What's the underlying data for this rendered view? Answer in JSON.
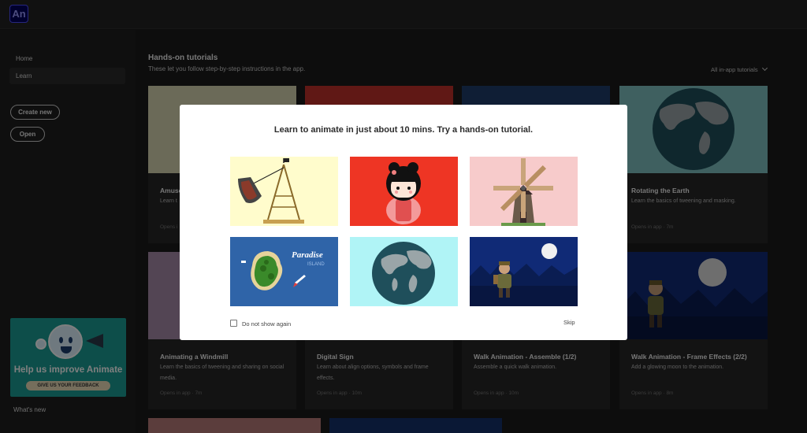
{
  "app": {
    "logo_text": "An",
    "brand_color": "#00005b"
  },
  "sidebar": {
    "items": [
      {
        "label": "Home"
      },
      {
        "label": "Learn",
        "active": true
      }
    ],
    "create_new": "Create new",
    "open": "Open",
    "promo": {
      "title": "Help us improve Animate",
      "button": "GIVE US YOUR FEEDBACK"
    },
    "whats_new": "What's new"
  },
  "main": {
    "title": "Hands-on tutorials",
    "subtitle": "These let you follow step-by-step instructions in the app.",
    "filter": "All in-app tutorials",
    "cards": [
      {
        "title": "Amuse",
        "desc": "Learn t",
        "meta": "Opens i"
      },
      {
        "title": "",
        "desc": "",
        "meta": ""
      },
      {
        "title": "",
        "desc": "",
        "meta": ""
      },
      {
        "title": "Rotating the Earth",
        "desc": "Learn the basics of tweening and masking.",
        "meta": "Opens in app  ·  7m"
      },
      {
        "title": "Animating a Windmill",
        "desc": "Learn the basics of tweening and sharing on social media.",
        "meta": "Opens in app  ·  7m"
      },
      {
        "title": "Digital Sign",
        "desc": "Learn about align options, symbols and frame effects.",
        "meta": "Opens in app  ·  10m"
      },
      {
        "title": "Walk Animation - Assemble (1/2)",
        "desc": "Assemble a quick walk animation.",
        "meta": "Opens in app  ·  10m"
      },
      {
        "title": "Walk Animation - Frame Effects (2/2)",
        "desc": "Add a glowing moon to the animation.",
        "meta": "Opens in app  ·  8m"
      }
    ]
  },
  "modal": {
    "title": "Learn to animate in just about 10 mins. Try a hands-on tutorial.",
    "tiles": [
      {
        "name": "amusement-ride",
        "bg": "#fffccc"
      },
      {
        "name": "kokeshi-doll",
        "bg": "#ee3524"
      },
      {
        "name": "windmill",
        "bg": "#f7cbcb"
      },
      {
        "name": "paradise-island",
        "bg": "#2f64a8",
        "text": "Paradise",
        "text2": "ISLAND"
      },
      {
        "name": "earth",
        "bg": "#b0f4f6"
      },
      {
        "name": "walk-animation",
        "bg": "#102a76"
      }
    ],
    "checkbox_label": "Do not show again",
    "checked": false,
    "skip": "Skip"
  }
}
